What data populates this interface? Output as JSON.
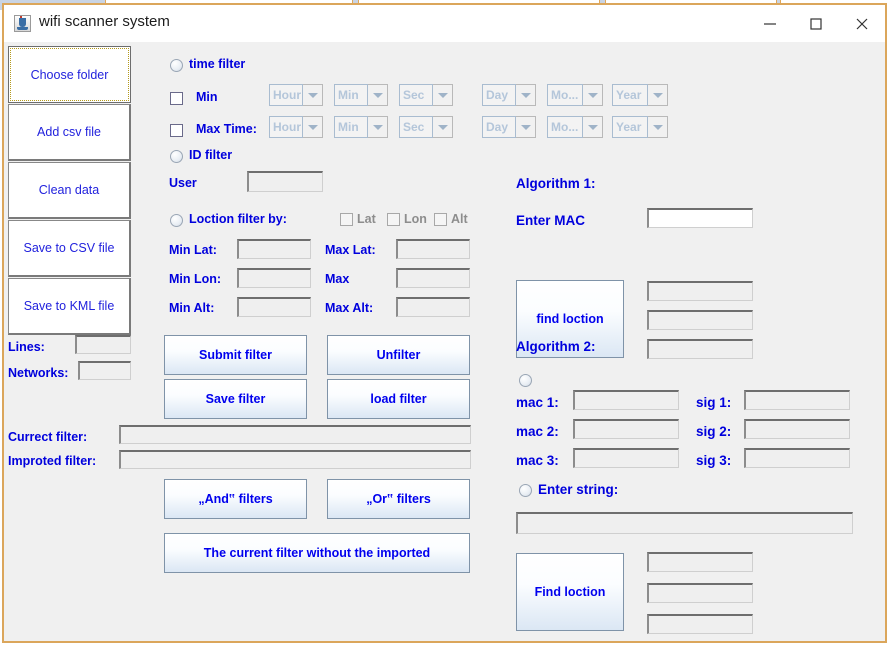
{
  "window": {
    "title": "wifi scanner system",
    "icon": "java-coffee-cup-icon",
    "minimize_label": "—",
    "maximize_label": "□",
    "close_label": "✕",
    "border_color": "#dba65b",
    "background_color": "#f0f0f0",
    "accent_text_color": "#0000dd"
  },
  "sidebar": {
    "buttons": [
      {
        "label": "Choose folder",
        "focused": true
      },
      {
        "label": "Add csv file",
        "focused": false
      },
      {
        "label": "Clean data",
        "focused": false
      },
      {
        "label": "Save to CSV file",
        "focused": false
      },
      {
        "label": "Save to KML file",
        "focused": false
      }
    ],
    "stats": [
      {
        "label": "Lines:",
        "value": ""
      },
      {
        "label": "Networks:",
        "value": ""
      }
    ]
  },
  "filters": {
    "time_filter": {
      "label": "time filter",
      "selected": false
    },
    "min_row": {
      "label": "Min",
      "checked": false,
      "combos": [
        {
          "name": "hour",
          "value": "Hour"
        },
        {
          "name": "minute",
          "value": "Min"
        },
        {
          "name": "second",
          "value": "Sec"
        },
        {
          "name": "day",
          "value": "Day"
        },
        {
          "name": "month",
          "value": "Mo..."
        },
        {
          "name": "year",
          "value": "Year"
        }
      ]
    },
    "max_row": {
      "label": "Max Time:",
      "checked": false,
      "combos": [
        {
          "name": "hour",
          "value": "Hour"
        },
        {
          "name": "minute",
          "value": "Min"
        },
        {
          "name": "second",
          "value": "Sec"
        },
        {
          "name": "day",
          "value": "Day"
        },
        {
          "name": "month",
          "value": "Mo..."
        },
        {
          "name": "year",
          "value": "Year"
        }
      ]
    },
    "id_filter": {
      "label": "ID filter",
      "selected": false
    },
    "user": {
      "label": "User",
      "value": ""
    },
    "location_filter": {
      "label": "Loction filter by:",
      "selected": false
    },
    "location_checkboxes": [
      {
        "label": "Lat",
        "checked": false,
        "enabled": false
      },
      {
        "label": "Lon",
        "checked": false,
        "enabled": false
      },
      {
        "label": "Alt",
        "checked": false,
        "enabled": false
      }
    ],
    "ranges": [
      {
        "min_label": "Min Lat:",
        "min_value": "",
        "max_label": "Max Lat:",
        "max_value": ""
      },
      {
        "min_label": "Min Lon:",
        "min_value": "",
        "max_label": "Max",
        "max_value": ""
      },
      {
        "min_label": "Min Alt:",
        "min_value": "",
        "max_label": "Max Alt:",
        "max_value": ""
      }
    ],
    "buttons": [
      {
        "label": "Submit filter"
      },
      {
        "label": "Unfilter"
      },
      {
        "label": "Save filter"
      },
      {
        "label": "load filter"
      }
    ],
    "current_filter": {
      "label": "Currect filter:",
      "value": ""
    },
    "imported_filter": {
      "label": "Improted filter:",
      "value": ""
    },
    "combine_buttons": [
      {
        "label": "„And‟ filters"
      },
      {
        "label": "„Or‟ filters"
      }
    ],
    "subtract_button": {
      "label": "The current filter without the imported"
    }
  },
  "algorithm1": {
    "title": "Algorithm 1:",
    "mac_label": "Enter MAC",
    "mac_value": "",
    "find_button": "find loction",
    "results": [
      "",
      "",
      ""
    ]
  },
  "algorithm2": {
    "title": "Algorithm 2:",
    "mode_macs_selected": false,
    "mode_string": {
      "label": "Enter string:",
      "selected": false
    },
    "rows": [
      {
        "mac_label": "mac 1:",
        "mac_value": "",
        "sig_label": "sig 1:",
        "sig_value": ""
      },
      {
        "mac_label": "mac 2:",
        "mac_value": "",
        "sig_label": "sig 2:",
        "sig_value": ""
      },
      {
        "mac_label": "mac 3:",
        "mac_value": "",
        "sig_label": "sig 3:",
        "sig_value": ""
      }
    ],
    "string_value": "",
    "find_button": "Find loction",
    "results": [
      "",
      "",
      ""
    ]
  }
}
